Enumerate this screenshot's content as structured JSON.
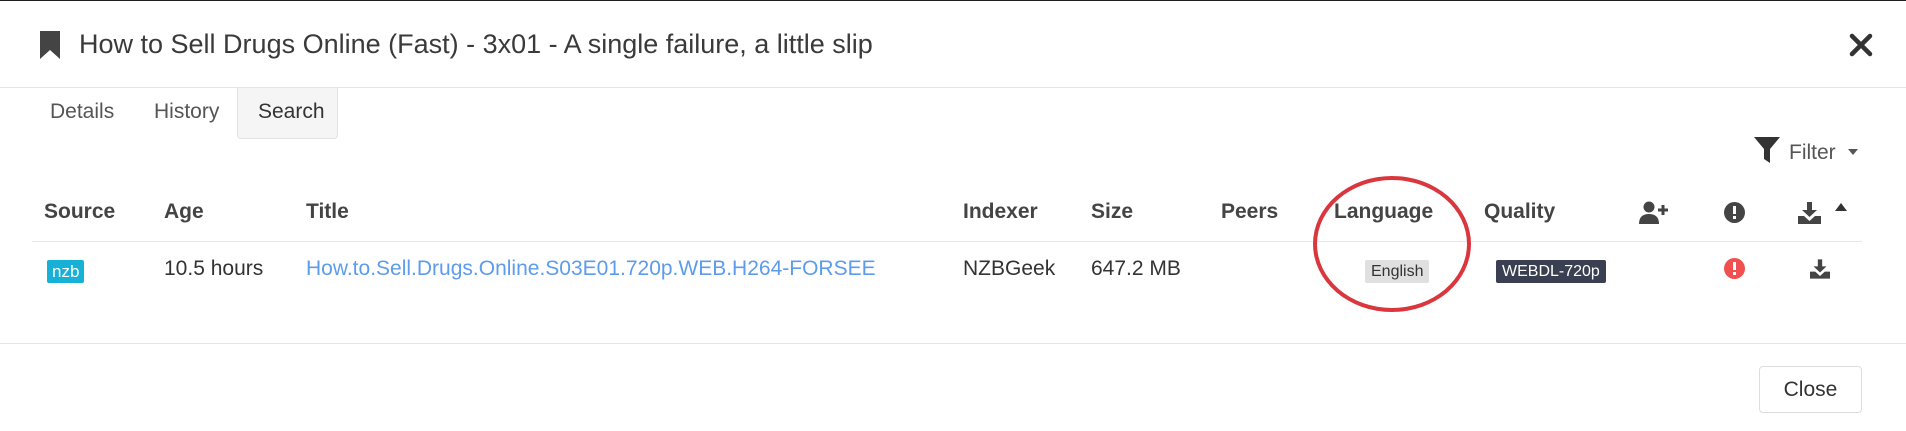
{
  "modal": {
    "title": "How to Sell Drugs Online (Fast) - 3x01 - A single failure, a little slip",
    "icon": "bookmark-icon",
    "close_icon": "close-icon"
  },
  "tabs": [
    {
      "label": "Details",
      "active": false
    },
    {
      "label": "History",
      "active": false
    },
    {
      "label": "Search",
      "active": true
    }
  ],
  "filter": {
    "label": "Filter",
    "icon": "filter-icon"
  },
  "table": {
    "columns": [
      "Source",
      "Age",
      "Title",
      "Indexer",
      "Size",
      "Peers",
      "Language",
      "Quality"
    ],
    "icon_columns": [
      "add-user-icon",
      "exclamation-circle-icon",
      "download-icon",
      "sort-ascending-icon"
    ],
    "rows": [
      {
        "source": "nzb",
        "age": "10.5 hours",
        "title": "How.to.Sell.Drugs.Online.S03E01.720p.WEB.H264-FORSEE",
        "indexer": "NZBGeek",
        "size": "647.2 MB",
        "peers": "",
        "language": "English",
        "quality": "WEBDL-720p",
        "status_icon": "error-circle-icon",
        "action_icon": "download-icon"
      }
    ]
  },
  "footer": {
    "close_label": "Close"
  },
  "colors": {
    "accent_link": "#5d9cec",
    "nzb_badge": "#17b1d7",
    "quality_badge": "#3a3f51",
    "language_badge": "#e0e0e0",
    "error": "#f05050",
    "annotation": "#d9363e"
  }
}
